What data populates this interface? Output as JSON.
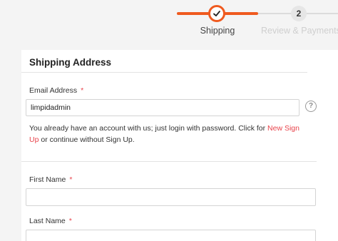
{
  "steps": {
    "step1": {
      "label": "Shipping",
      "state": "done"
    },
    "step2": {
      "number": "2",
      "label": "Review & Payments",
      "state": "todo"
    }
  },
  "form": {
    "title": "Shipping Address",
    "email": {
      "label": "Email Address",
      "required_mark": "*",
      "value": "limpidadmin"
    },
    "help_icon_glyph": "?",
    "notice": {
      "before": "You already have an account with us; just login with password. Click for ",
      "link": "New Sign Up",
      "after": " or continue without Sign Up."
    },
    "first_name": {
      "label": "First Name",
      "required_mark": "*",
      "value": ""
    },
    "last_name": {
      "label": "Last Name",
      "required_mark": "*",
      "value": ""
    }
  },
  "colors": {
    "accent": "#ef5a1f",
    "link": "#e8434b",
    "background": "#f4f4f4"
  },
  "icons": {
    "step1": "checkmark-icon",
    "help": "question-icon"
  }
}
